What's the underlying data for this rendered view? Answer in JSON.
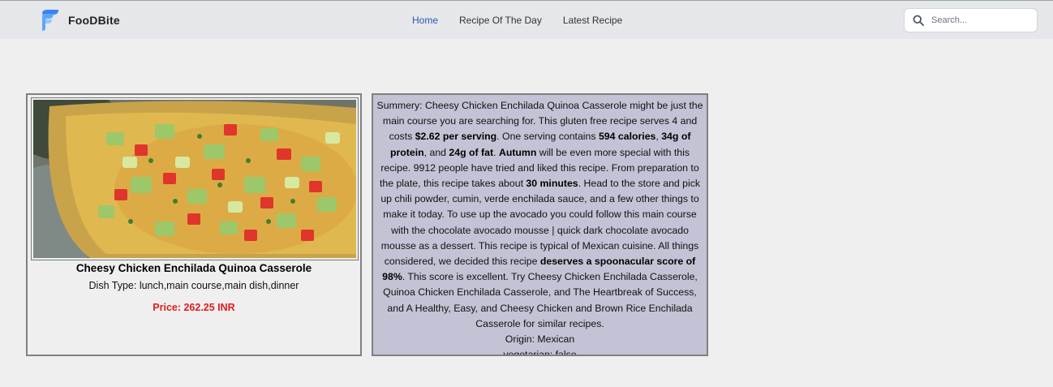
{
  "brand": {
    "name": "FooDBite"
  },
  "nav": {
    "items": [
      {
        "label": "Home",
        "active": true
      },
      {
        "label": "Recipe Of The Day",
        "active": false
      },
      {
        "label": "Latest Recipe",
        "active": false
      }
    ]
  },
  "search": {
    "placeholder": "Search...",
    "value": ""
  },
  "recipe": {
    "title": "Cheesy Chicken Enchilada Quinoa Casserole",
    "dish_type": "Dish Type: lunch,main course,main dish,dinner",
    "price": "Price: 262.25 INR"
  },
  "summary": {
    "p1": "Summery: Cheesy Chicken Enchilada Quinoa Casserole might be just the main course you are searching for. This gluten free recipe serves 4 and costs ",
    "b1": "$2.62 per serving",
    "p2": ". One serving contains ",
    "b2": "594 calories",
    "p3": ", ",
    "b3": "34g of protein",
    "p4": ", and ",
    "b4": "24g of fat",
    "p5": ". ",
    "b5": "Autumn",
    "p6": " will be even more special with this recipe. 9912 people have tried and liked this recipe. From preparation to the plate, this recipe takes about ",
    "b6": "30 minutes",
    "p7": ". Head to the store and pick up chili powder, cumin, verde enchilada sauce, and a few other things to make it today. To use up the avocado you could follow this main course with the chocolate avocado mousse | quick dark chocolate avocado mousse as a dessert. This recipe is typical of Mexican cuisine. All things considered, we decided this recipe ",
    "b7": "deserves a spoonacular score of 98%",
    "p8": ". This score is excellent. Try Cheesy Chicken Enchilada Casserole, Quinoa Chicken Enchilada Casserole, and The Heartbreak of Success, and A Healthy, Easy, and Cheesy Chicken and Brown Rice Enchilada Casserole for similar recipes.",
    "origin": "Origin: Mexican",
    "vegetarian": "vegetarian: false"
  },
  "colors": {
    "navbar": "#e5e7eb",
    "nav_active": "#3352b6",
    "price": "#e11d1d",
    "summary_bg": "#c3c3d5",
    "logo": "#3b82f6"
  }
}
